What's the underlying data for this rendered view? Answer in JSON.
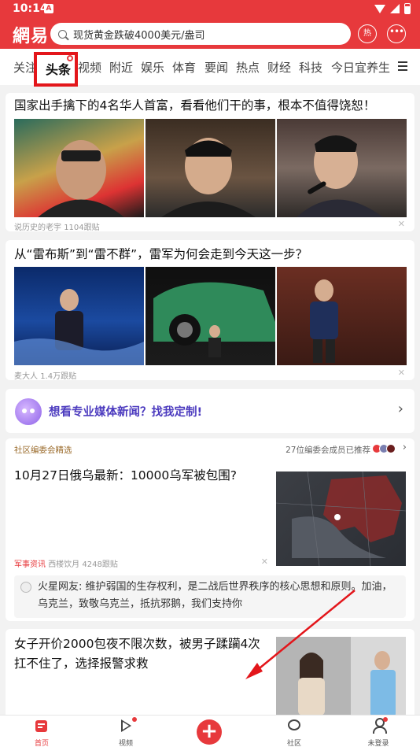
{
  "status_bar": {
    "time": "10:14",
    "app_badge": "A"
  },
  "header": {
    "logo": "網易",
    "search_placeholder": "现货黄金跌破4000美元/盎司",
    "hot_label": "热",
    "message_label": "•••"
  },
  "tabs": [
    "关注",
    "头条",
    "视频",
    "附近",
    "娱乐",
    "体育",
    "要闻",
    "热点",
    "财经",
    "科技",
    "今日宜养生"
  ],
  "active_tab": "头条",
  "articles": [
    {
      "title": "国家出手擒下的4名华人首富，看看他们干的事，根本不值得饶恕！",
      "source": "说历史的老宇",
      "comments": "1104跟贴"
    },
    {
      "title": "从“雷布斯”到“雷不群”，雷军为何会走到今天这一步？",
      "source": "麦大人",
      "comments": "1.4万跟贴"
    }
  ],
  "promo": {
    "text": "想看专业媒体新闻？找我定制!"
  },
  "community": {
    "section_label": "社区编委会精选",
    "recommend_text": "27位编委会成员已推荐",
    "title": "10月27日俄乌最新：10000乌军被包围?",
    "tag": "军事资讯",
    "source": "西楼饮月",
    "comments": "4248跟贴",
    "comment_user": "火星网友:",
    "comment_text": "维护弱国的生存权利，是二战后世界秩序的核心思想和原则。加油，乌克兰，致敬乌克兰，抵抗邪鹅，我们支持你"
  },
  "article3": {
    "title": "女子开价2000包夜不限次数，被男子蹂躏4次扛不住了，选择报警求救"
  },
  "bottom_nav": {
    "home": "首页",
    "video": "视频",
    "community": "社区",
    "profile": "未登录"
  },
  "colors": {
    "brand_red": "#e7393c",
    "highlight_box": "#e3161b",
    "promo_purple": "#4c3bbf"
  }
}
